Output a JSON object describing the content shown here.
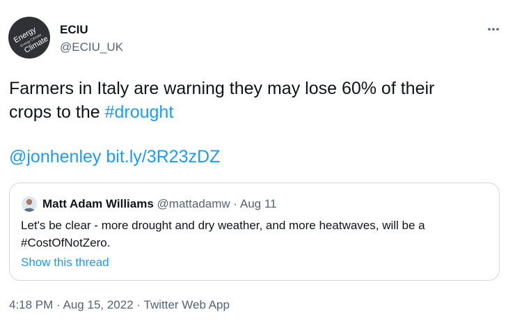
{
  "author": {
    "display_name": "ECIU",
    "handle": "@ECIU_UK",
    "avatar": {
      "words": [
        "Energy",
        "Energy Climate",
        "Climate"
      ],
      "background_color": "#2f3136"
    }
  },
  "more_icon": "more-horizontal-icon",
  "tweet": {
    "line1": "Farmers in Italy are warning they may lose 60% of their",
    "line2_text": "crops to the ",
    "hashtag": "#drought",
    "mention": "@jonhenley",
    "url": "bit.ly/3R23zDZ"
  },
  "quoted_tweet": {
    "display_name": "Matt Adam Williams",
    "handle": "@mattadamw",
    "separator": "·",
    "date": "Aug 11",
    "text_line1": "Let's be clear - more drought and dry weather, and more heatwaves, will be a",
    "text_line2": "#CostOfNotZero.",
    "show_thread": "Show this thread"
  },
  "meta": {
    "time": "4:18 PM",
    "separator": "·",
    "date": "Aug 15, 2022",
    "source": "Twitter Web App"
  },
  "colors": {
    "link": "#1d9bf0",
    "text": "#0f1419",
    "secondary": "#536471",
    "border": "#cfd9de"
  }
}
